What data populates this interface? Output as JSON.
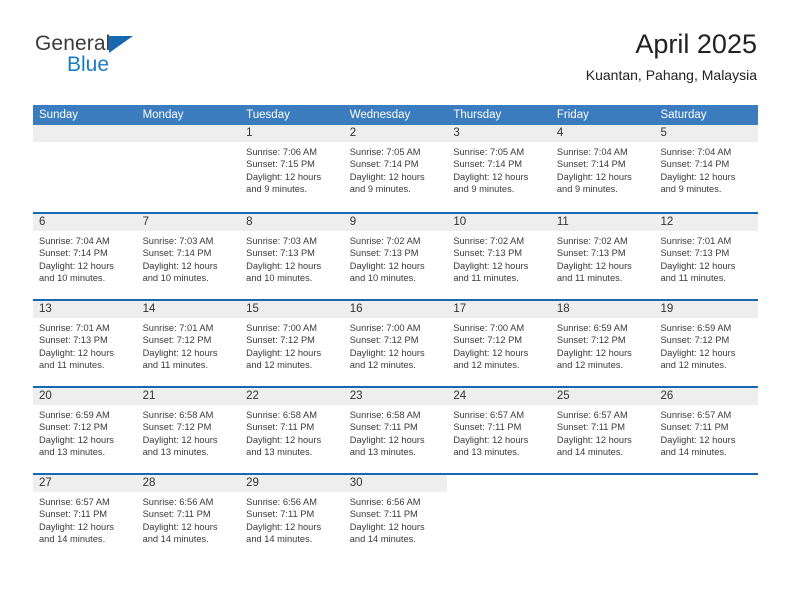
{
  "brand": {
    "name_top": "General",
    "name_bottom": "Blue",
    "accent_color": "#1668b3",
    "blue_text_color": "#1b7cc4"
  },
  "header": {
    "title": "April 2025",
    "subtitle": "Kuantan, Pahang, Malaysia"
  },
  "calendar": {
    "header_bg": "#3a7cbe",
    "week_rule_color": "#1668b3",
    "daynum_bg": "#eeeeee",
    "weekdays": [
      "Sunday",
      "Monday",
      "Tuesday",
      "Wednesday",
      "Thursday",
      "Friday",
      "Saturday"
    ],
    "weeks": [
      [
        {
          "day": "",
          "lines": []
        },
        {
          "day": "",
          "lines": []
        },
        {
          "day": "1",
          "lines": [
            "Sunrise: 7:06 AM",
            "Sunset: 7:15 PM",
            "Daylight: 12 hours",
            "and 9 minutes."
          ]
        },
        {
          "day": "2",
          "lines": [
            "Sunrise: 7:05 AM",
            "Sunset: 7:14 PM",
            "Daylight: 12 hours",
            "and 9 minutes."
          ]
        },
        {
          "day": "3",
          "lines": [
            "Sunrise: 7:05 AM",
            "Sunset: 7:14 PM",
            "Daylight: 12 hours",
            "and 9 minutes."
          ]
        },
        {
          "day": "4",
          "lines": [
            "Sunrise: 7:04 AM",
            "Sunset: 7:14 PM",
            "Daylight: 12 hours",
            "and 9 minutes."
          ]
        },
        {
          "day": "5",
          "lines": [
            "Sunrise: 7:04 AM",
            "Sunset: 7:14 PM",
            "Daylight: 12 hours",
            "and 9 minutes."
          ]
        }
      ],
      [
        {
          "day": "6",
          "lines": [
            "Sunrise: 7:04 AM",
            "Sunset: 7:14 PM",
            "Daylight: 12 hours",
            "and 10 minutes."
          ]
        },
        {
          "day": "7",
          "lines": [
            "Sunrise: 7:03 AM",
            "Sunset: 7:14 PM",
            "Daylight: 12 hours",
            "and 10 minutes."
          ]
        },
        {
          "day": "8",
          "lines": [
            "Sunrise: 7:03 AM",
            "Sunset: 7:13 PM",
            "Daylight: 12 hours",
            "and 10 minutes."
          ]
        },
        {
          "day": "9",
          "lines": [
            "Sunrise: 7:02 AM",
            "Sunset: 7:13 PM",
            "Daylight: 12 hours",
            "and 10 minutes."
          ]
        },
        {
          "day": "10",
          "lines": [
            "Sunrise: 7:02 AM",
            "Sunset: 7:13 PM",
            "Daylight: 12 hours",
            "and 11 minutes."
          ]
        },
        {
          "day": "11",
          "lines": [
            "Sunrise: 7:02 AM",
            "Sunset: 7:13 PM",
            "Daylight: 12 hours",
            "and 11 minutes."
          ]
        },
        {
          "day": "12",
          "lines": [
            "Sunrise: 7:01 AM",
            "Sunset: 7:13 PM",
            "Daylight: 12 hours",
            "and 11 minutes."
          ]
        }
      ],
      [
        {
          "day": "13",
          "lines": [
            "Sunrise: 7:01 AM",
            "Sunset: 7:13 PM",
            "Daylight: 12 hours",
            "and 11 minutes."
          ]
        },
        {
          "day": "14",
          "lines": [
            "Sunrise: 7:01 AM",
            "Sunset: 7:12 PM",
            "Daylight: 12 hours",
            "and 11 minutes."
          ]
        },
        {
          "day": "15",
          "lines": [
            "Sunrise: 7:00 AM",
            "Sunset: 7:12 PM",
            "Daylight: 12 hours",
            "and 12 minutes."
          ]
        },
        {
          "day": "16",
          "lines": [
            "Sunrise: 7:00 AM",
            "Sunset: 7:12 PM",
            "Daylight: 12 hours",
            "and 12 minutes."
          ]
        },
        {
          "day": "17",
          "lines": [
            "Sunrise: 7:00 AM",
            "Sunset: 7:12 PM",
            "Daylight: 12 hours",
            "and 12 minutes."
          ]
        },
        {
          "day": "18",
          "lines": [
            "Sunrise: 6:59 AM",
            "Sunset: 7:12 PM",
            "Daylight: 12 hours",
            "and 12 minutes."
          ]
        },
        {
          "day": "19",
          "lines": [
            "Sunrise: 6:59 AM",
            "Sunset: 7:12 PM",
            "Daylight: 12 hours",
            "and 12 minutes."
          ]
        }
      ],
      [
        {
          "day": "20",
          "lines": [
            "Sunrise: 6:59 AM",
            "Sunset: 7:12 PM",
            "Daylight: 12 hours",
            "and 13 minutes."
          ]
        },
        {
          "day": "21",
          "lines": [
            "Sunrise: 6:58 AM",
            "Sunset: 7:12 PM",
            "Daylight: 12 hours",
            "and 13 minutes."
          ]
        },
        {
          "day": "22",
          "lines": [
            "Sunrise: 6:58 AM",
            "Sunset: 7:11 PM",
            "Daylight: 12 hours",
            "and 13 minutes."
          ]
        },
        {
          "day": "23",
          "lines": [
            "Sunrise: 6:58 AM",
            "Sunset: 7:11 PM",
            "Daylight: 12 hours",
            "and 13 minutes."
          ]
        },
        {
          "day": "24",
          "lines": [
            "Sunrise: 6:57 AM",
            "Sunset: 7:11 PM",
            "Daylight: 12 hours",
            "and 13 minutes."
          ]
        },
        {
          "day": "25",
          "lines": [
            "Sunrise: 6:57 AM",
            "Sunset: 7:11 PM",
            "Daylight: 12 hours",
            "and 14 minutes."
          ]
        },
        {
          "day": "26",
          "lines": [
            "Sunrise: 6:57 AM",
            "Sunset: 7:11 PM",
            "Daylight: 12 hours",
            "and 14 minutes."
          ]
        }
      ],
      [
        {
          "day": "27",
          "lines": [
            "Sunrise: 6:57 AM",
            "Sunset: 7:11 PM",
            "Daylight: 12 hours",
            "and 14 minutes."
          ]
        },
        {
          "day": "28",
          "lines": [
            "Sunrise: 6:56 AM",
            "Sunset: 7:11 PM",
            "Daylight: 12 hours",
            "and 14 minutes."
          ]
        },
        {
          "day": "29",
          "lines": [
            "Sunrise: 6:56 AM",
            "Sunset: 7:11 PM",
            "Daylight: 12 hours",
            "and 14 minutes."
          ]
        },
        {
          "day": "30",
          "lines": [
            "Sunrise: 6:56 AM",
            "Sunset: 7:11 PM",
            "Daylight: 12 hours",
            "and 14 minutes."
          ]
        },
        {
          "day": "",
          "lines": [],
          "blank": true
        },
        {
          "day": "",
          "lines": [],
          "blank": true
        },
        {
          "day": "",
          "lines": [],
          "blank": true
        }
      ]
    ]
  }
}
